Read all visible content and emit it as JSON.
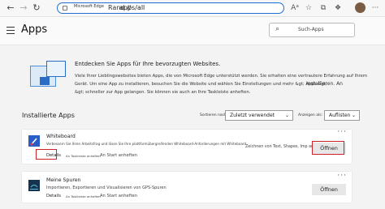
{
  "browser": {
    "edge_label": "Microsoft Edge",
    "separator": "Rand //",
    "url_path": "apps/all"
  },
  "header": {
    "title": "Apps",
    "search_placeholder": "Such-Apps"
  },
  "banner": {
    "title": "Entdecken Sie Apps für Ihre bevorzugten Websites.",
    "lines": [
      "Viele Ihrer Lieblingswebsites bieten Apps, die von Microsoft Edge unterstützt werden. Sie erhalten eine vertrautere Erfahrung auf Ihrem",
      "Gerät. Um eine App zu installieren, besuchen Sie die Website und wählen Sie Einstellungen und mehr &gt; Apps &gt;",
      "Installieren. An",
      "&gt; schneller zur App gelangen. Sie können sie auch an Ihre Taskleiste anheften."
    ]
  },
  "installed": {
    "title": "Installierte Apps",
    "sort_label": "Sortieren nach:",
    "sort_value": "Zuletzt verwendet",
    "view_label": "Anzeigen als:",
    "view_value": "Auflisten"
  },
  "apps": [
    {
      "name": "Whiteboard",
      "description": "Verbessern Sie Ihren Arbeitsfrag und lösen Sie Ihre plattformübergreifenden Whiteboard-Anforderungen mit Whiteboard",
      "description_right": "Zeichnen von Text, Shapes, Imp anfügen",
      "details": "Details",
      "taskbar": "An Taskleiste anheften",
      "start": "An Start anheften",
      "open": "Öffnen"
    },
    {
      "name": "Meine Spuren",
      "description": "Importieren, Exportieren und Visualisieren von GPS-Spuren",
      "details": "Details",
      "taskbar": "An Taskleiste anheften",
      "start": "An Start anheften",
      "open": "Öffnen"
    }
  ]
}
